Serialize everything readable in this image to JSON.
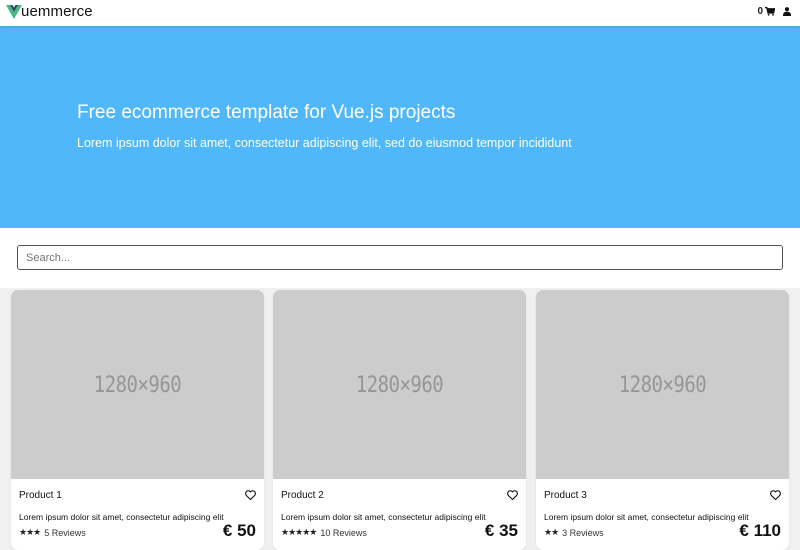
{
  "nav": {
    "brand_text": "uemmerce",
    "cart_count": "0",
    "logo_colors": [
      "#42b883",
      "#35495e"
    ]
  },
  "hero": {
    "title": "Free ecommerce template for Vue.js projects",
    "subtitle": "Lorem ipsum dolor sit amet, consectetur adipiscing elit, sed do eiusmod tempor incididunt",
    "background": "#50b7fa"
  },
  "search": {
    "placeholder": "Search..."
  },
  "products": [
    {
      "image_label": "1280×960",
      "name": "Product 1",
      "description": "Lorem ipsum dolor sit amet, consectetur adipiscing elit",
      "stars": "★★★",
      "reviews": "5 Reviews",
      "price": "€ 50"
    },
    {
      "image_label": "1280×960",
      "name": "Product 2",
      "description": "Lorem ipsum dolor sit amet, consectetur adipiscing elit",
      "stars": "★★★★★",
      "reviews": "10 Reviews",
      "price": "€ 35"
    },
    {
      "image_label": "1280×960",
      "name": "Product 3",
      "description": "Lorem ipsum dolor sit amet, consectetur adipiscing elit",
      "stars": "★★",
      "reviews": "3 Reviews",
      "price": "€ 110"
    }
  ]
}
